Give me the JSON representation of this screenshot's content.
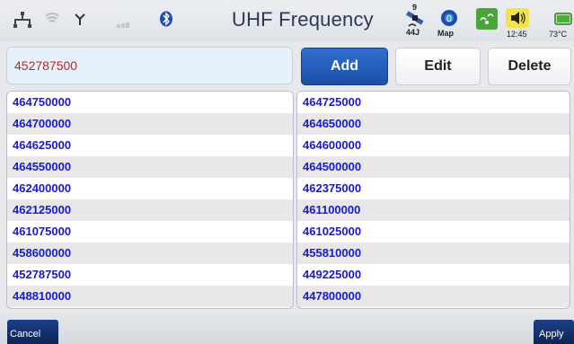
{
  "header": {
    "title": "UHF Frequency",
    "satellite_count": "9",
    "satellite_label": "44J",
    "map_label": "Map",
    "time": "12:45",
    "temperature": "73°C",
    "icons": [
      "network-icon",
      "wifi-icon",
      "antenna-icon",
      "signal-bars-icon",
      "bluetooth-icon",
      "satellite-icon",
      "map-icon",
      "wireless-display-icon",
      "volume-icon",
      "battery-icon"
    ]
  },
  "input": {
    "value": "452787500"
  },
  "actions": {
    "add_label": "Add",
    "edit_label": "Edit",
    "delete_label": "Delete"
  },
  "lists": {
    "left": [
      "464750000",
      "464700000",
      "464625000",
      "464550000",
      "462400000",
      "462125000",
      "461075000",
      "458600000",
      "452787500",
      "448810000"
    ],
    "right": [
      "464725000",
      "464650000",
      "464600000",
      "464500000",
      "462375000",
      "461100000",
      "461025000",
      "455810000",
      "449225000",
      "447800000"
    ]
  },
  "footer": {
    "cancel_label": "Cancel",
    "apply_label": "Apply"
  },
  "colors": {
    "accent": "#1c4fa6",
    "input_text": "#c0261f",
    "list_text": "#1818d6",
    "row_alt": "#e7e7e7"
  }
}
